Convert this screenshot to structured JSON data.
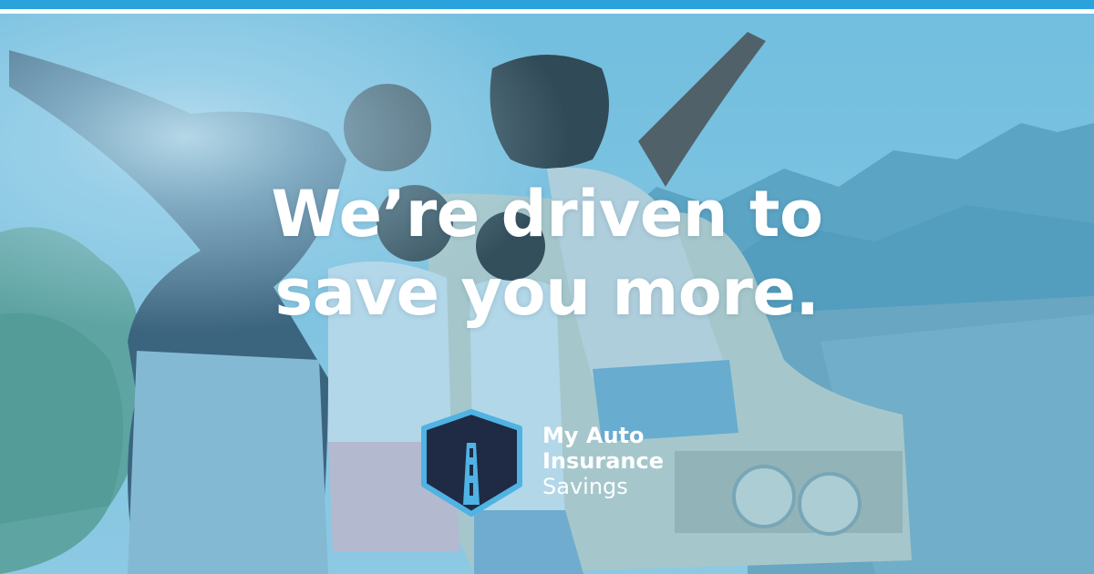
{
  "headline": {
    "line1": "We’re driven to",
    "line2": "save you more."
  },
  "logo": {
    "line1": "My Auto",
    "line2": "Insurance",
    "line3": "Savings",
    "icon": "road-shield-icon"
  },
  "colors": {
    "top_bar": "#2aa3dc",
    "overlay_tint": "#40a0cd",
    "logo_shield_fill": "#1f2a44",
    "logo_shield_border": "#4fb3e3",
    "text": "#ffffff"
  }
}
